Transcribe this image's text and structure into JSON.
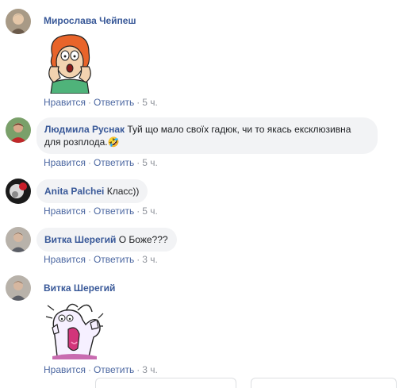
{
  "comments": [
    {
      "author": "Мирослава Чейпеш",
      "text": "",
      "sticker": "lois-shocked-sticker",
      "actions": {
        "like": "Нравится",
        "reply": "Ответить",
        "time": "5 ч."
      }
    },
    {
      "author": "Людмила Руснак",
      "text": "Туй що мало своїх гадюк, чи то якась ексклюзивна для розплода.",
      "emoji": "🤣",
      "actions": {
        "like": "Нравится",
        "reply": "Ответить",
        "time": "5 ч."
      }
    },
    {
      "author": "Anita Palchei",
      "text": "Класс))",
      "actions": {
        "like": "Нравится",
        "reply": "Ответить",
        "time": "5 ч."
      }
    },
    {
      "author": "Витка Шерегий",
      "text": "О Боже???",
      "actions": {
        "like": "Нравится",
        "reply": "Ответить",
        "time": "3 ч."
      }
    },
    {
      "author": "Витка Шерегий",
      "text": "",
      "sticker": "screaming-character-sticker",
      "actions": {
        "like": "Нравится",
        "reply": "Ответить",
        "time": "3 ч."
      }
    }
  ],
  "separator": "·"
}
